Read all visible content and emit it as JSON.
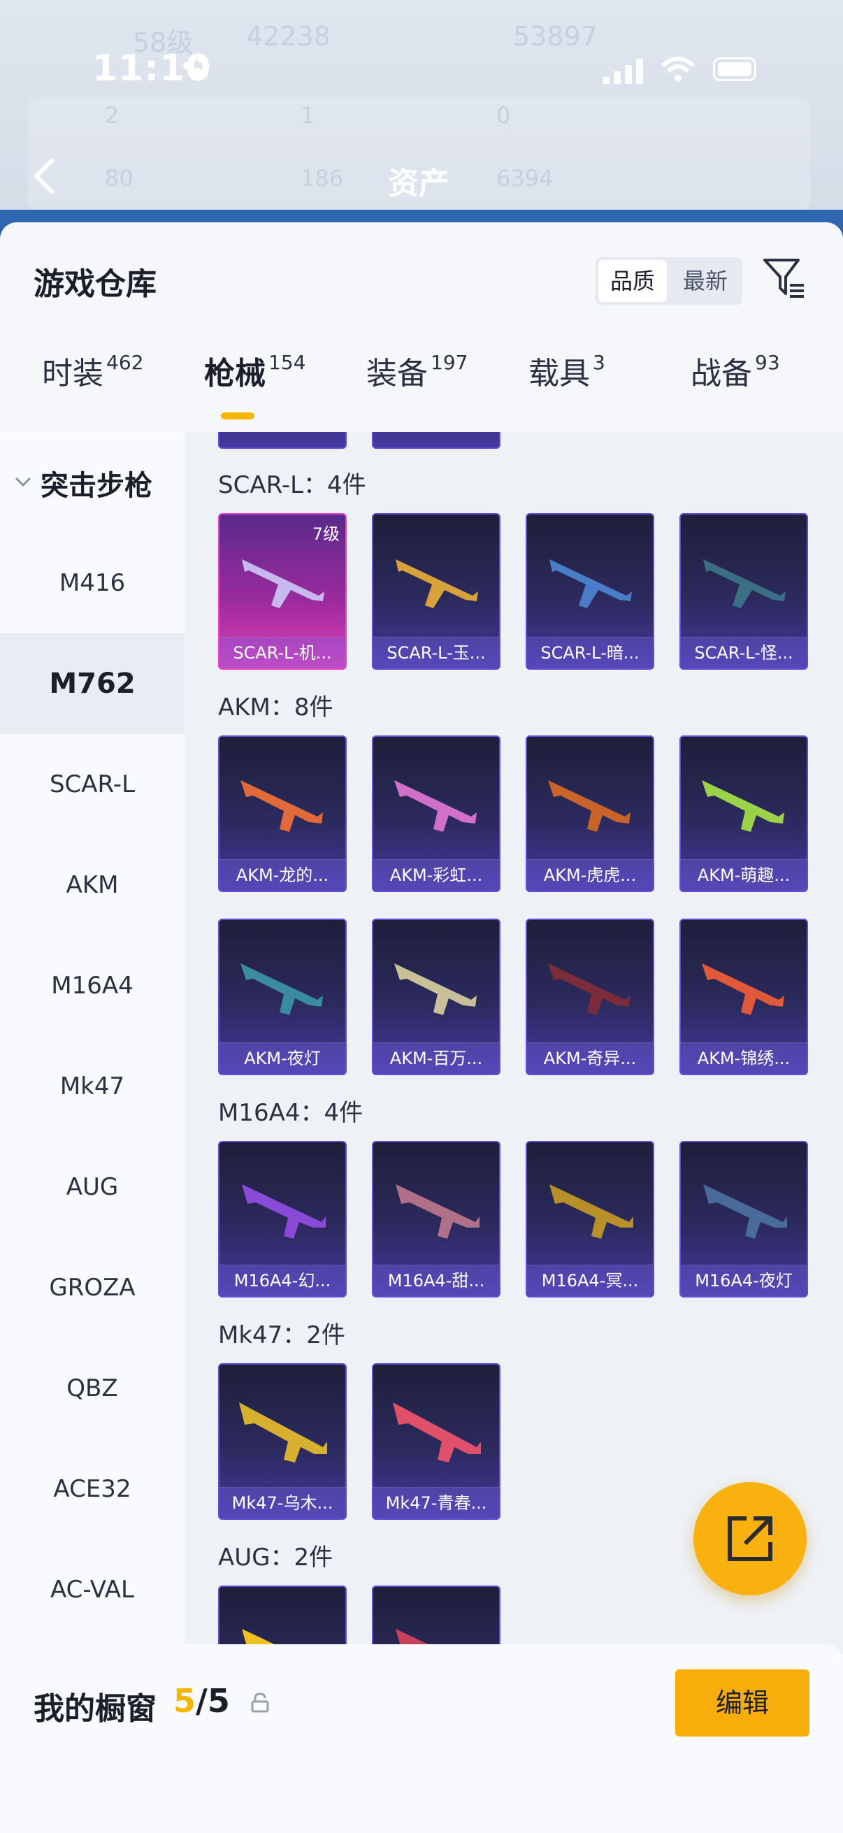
{
  "status_bar": {
    "time": "11:10"
  },
  "background_header": {
    "title": "资产",
    "ghost_texts": [
      "58级",
      "42238",
      "53897",
      "2",
      "1",
      "0",
      "80",
      "186",
      "6394"
    ]
  },
  "panel": {
    "title": "游戏仓库",
    "sort_options": [
      "品质",
      "最新"
    ]
  },
  "tabs": [
    {
      "label": "时装",
      "count": "462"
    },
    {
      "label": "枪械",
      "count": "154"
    },
    {
      "label": "装备",
      "count": "197"
    },
    {
      "label": "载具",
      "count": "3"
    },
    {
      "label": "战备",
      "count": "93"
    }
  ],
  "sidebar": {
    "category": "突击步枪",
    "items": [
      "M416",
      "M762",
      "SCAR-L",
      "AKM",
      "M16A4",
      "Mk47",
      "AUG",
      "GROZA",
      "QBZ",
      "ACE32",
      "AC-VAL"
    ]
  },
  "sections": [
    {
      "title": "SCAR-L：4件",
      "items": [
        "SCAR-L-机...",
        "SCAR-L-玉...",
        "SCAR-L-暗...",
        "SCAR-L-怪..."
      ],
      "level_badge": "7级"
    },
    {
      "title": "AKM：8件",
      "items": [
        "AKM-龙的...",
        "AKM-彩虹...",
        "AKM-虎虎...",
        "AKM-萌趣...",
        "AKM-夜灯",
        "AKM-百万...",
        "AKM-奇异...",
        "AKM-锦绣..."
      ]
    },
    {
      "title": "M16A4：4件",
      "items": [
        "M16A4-幻...",
        "M16A4-甜...",
        "M16A4-冥...",
        "M16A4-夜灯"
      ]
    },
    {
      "title": "Mk47：2件",
      "items": [
        "Mk47-乌木...",
        "Mk47-青春..."
      ]
    },
    {
      "title": "AUG：2件",
      "items": []
    }
  ],
  "bottom_bar": {
    "title": "我的橱窗",
    "count_current": "5",
    "count_separator": "/",
    "count_total": "5",
    "edit_label": "编辑"
  },
  "colors": {
    "accent": "#f7b500",
    "card_border": "#5b4fd4",
    "card_pink": "#e844c4"
  },
  "icons": [
    "paw-icon",
    "signal-icon",
    "wifi-icon",
    "battery-icon",
    "back-icon",
    "filter-icon",
    "chevron-down-icon",
    "share-icon",
    "lock-icon"
  ]
}
